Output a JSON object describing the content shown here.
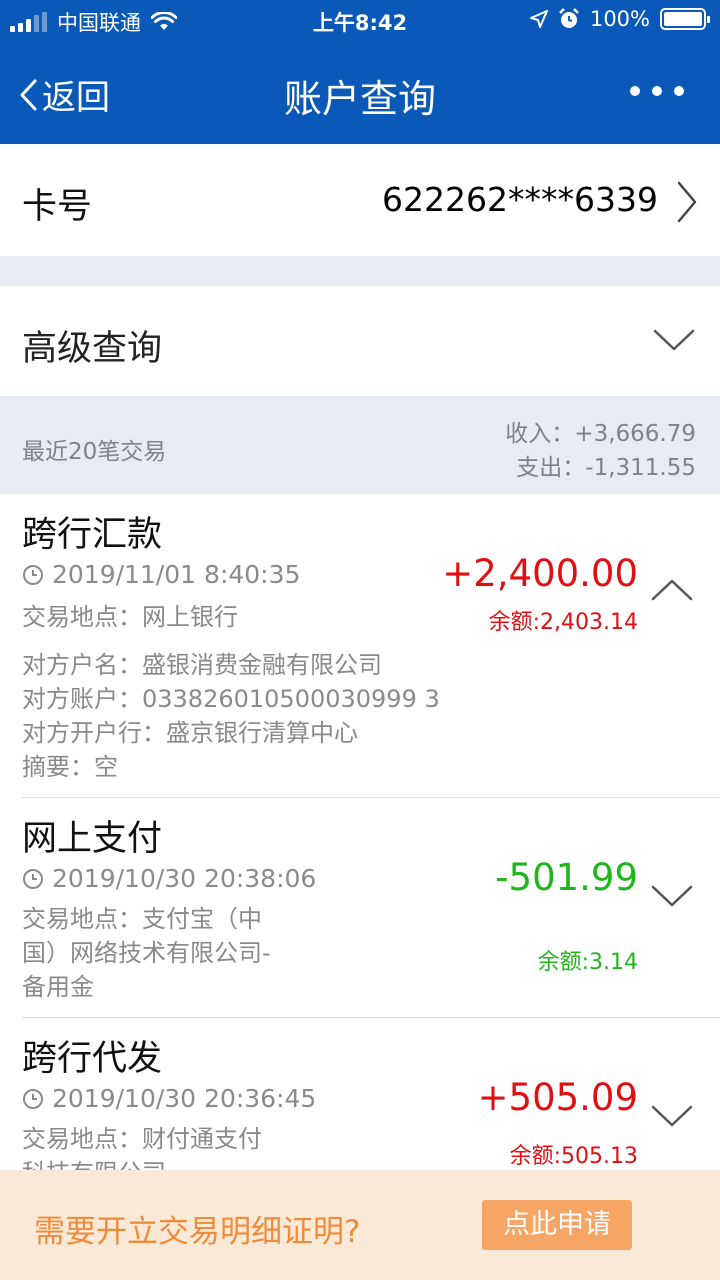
{
  "status_bar": {
    "carrier": "中国联通",
    "time": "上午8:42",
    "battery": "100%"
  },
  "nav": {
    "back_label": "返回",
    "title": "账户查询"
  },
  "card": {
    "label": "卡号",
    "number": "622262****6339"
  },
  "advanced": {
    "label": "高级查询"
  },
  "summary": {
    "label": "最近20笔交易",
    "income": "收入：+3,666.79",
    "expense": "支出：-1,311.55"
  },
  "transactions": [
    {
      "type": "跨行汇款",
      "time": "2019/11/01 8:40:35",
      "location": "交易地点：网上银行",
      "amount": "+2,400.00",
      "balance": "余额:2,403.14",
      "direction": "in",
      "expanded": true,
      "details": [
        "对方户名：盛银消费金融有限公司",
        "对方账户：033826010500030999 3",
        "对方开户行：盛京银行清算中心",
        "摘要：空"
      ]
    },
    {
      "type": "网上支付",
      "time": "2019/10/30 20:38:06",
      "location_lines": [
        "交易地点：支付宝（中",
        "国）网络技术有限公司-",
        "备用金"
      ],
      "amount": "-501.99",
      "balance": "余额:3.14",
      "direction": "out",
      "expanded": false
    },
    {
      "type": "跨行代发",
      "time": "2019/10/30 20:36:45",
      "location_lines": [
        "交易地点：财付通支付",
        "科技有限公司"
      ],
      "amount": "+505.09",
      "balance": "余额:505.13",
      "direction": "in",
      "expanded": false
    }
  ],
  "certificate": {
    "prompt": "需要开立交易明细证明?",
    "button": "点此申请"
  },
  "colors": {
    "brand_blue": "#0a59b8",
    "income_red": "#e10e12",
    "expense_green": "#21b61c",
    "cert_orange": "#f08b3c"
  }
}
